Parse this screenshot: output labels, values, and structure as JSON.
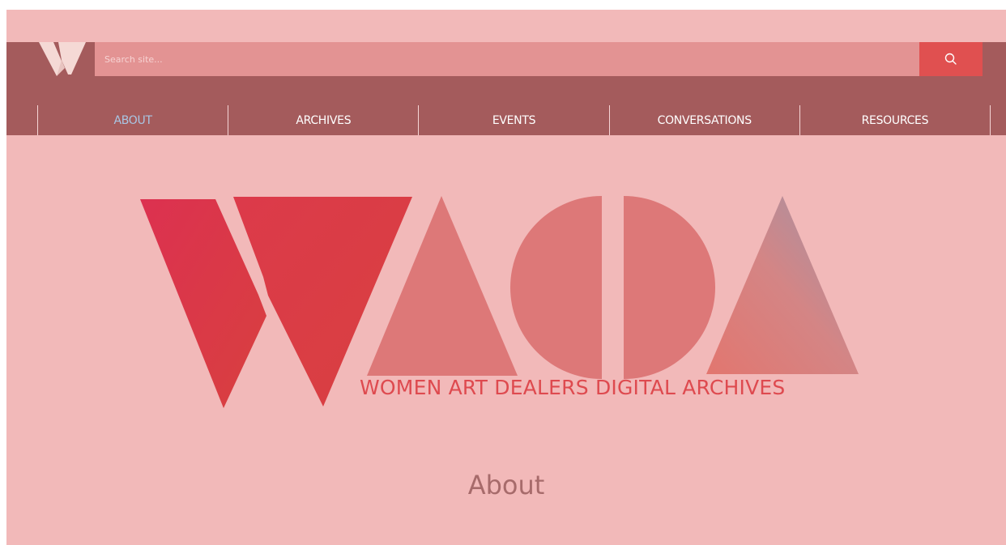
{
  "search": {
    "placeholder": "Search site...",
    "button_icon": "search-icon"
  },
  "nav": {
    "items": [
      {
        "label": "ABOUT",
        "active": true
      },
      {
        "label": "ARCHIVES",
        "active": false
      },
      {
        "label": "EVENTS",
        "active": false
      },
      {
        "label": "CONVERSATIONS",
        "active": false
      },
      {
        "label": "RESOURCES",
        "active": false
      }
    ]
  },
  "hero": {
    "tagline": "WOMEN ART DEALERS DIGITAL ARCHIVES",
    "logo_letters": "WADA"
  },
  "main": {
    "heading": "About"
  },
  "colors": {
    "page_background": "#f2b9b9",
    "header_background": "#a45b5c",
    "search_field": "#e39393",
    "search_button": "#e05050",
    "nav_active": "#a9c6e4",
    "accent_red": "#de4a4f",
    "shape_coral": "#dd7878",
    "heading_text": "#a76b6b"
  }
}
